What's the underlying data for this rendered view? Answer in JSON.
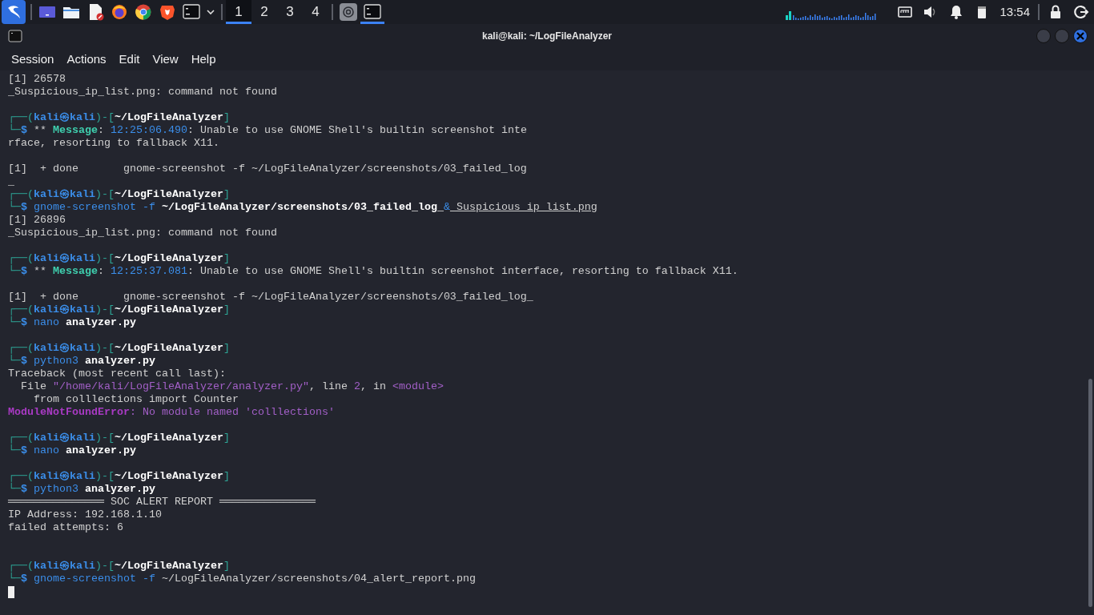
{
  "taskbar": {
    "workspaces": [
      {
        "label": "1",
        "selected": true
      },
      {
        "label": "2",
        "selected": false
      },
      {
        "label": "3",
        "selected": false
      },
      {
        "label": "4",
        "selected": false
      }
    ],
    "tasks": [
      {
        "kind": "assistant",
        "active": false
      },
      {
        "kind": "terminal",
        "active": true
      }
    ],
    "clock": "13:54"
  },
  "window": {
    "title": "kali@kali: ~/LogFileAnalyzer"
  },
  "menu": [
    "Session",
    "Actions",
    "Edit",
    "View",
    "Help"
  ],
  "terminal": {
    "lines": [
      {
        "kind": "text",
        "segments": [
          {
            "kind": "plain",
            "text": "[1] 26578"
          }
        ]
      },
      {
        "kind": "text",
        "segments": [
          {
            "kind": "plain",
            "text": "_Suspicious_ip_list.png: command not found"
          }
        ]
      },
      {
        "kind": "blank"
      },
      {
        "kind": "text",
        "segments": [
          {
            "kind": "frame",
            "text": "┌──("
          },
          {
            "kind": "user",
            "text": "kali㉿kali"
          },
          {
            "kind": "frame",
            "text": ")-["
          },
          {
            "kind": "path",
            "text": "~/LogFileAnalyzer"
          },
          {
            "kind": "frame",
            "text": "]"
          }
        ]
      },
      {
        "kind": "text",
        "segments": [
          {
            "kind": "frame",
            "text": "└─"
          },
          {
            "kind": "user",
            "text": "$"
          },
          {
            "kind": "plain",
            "text": " ** "
          },
          {
            "kind": "msg",
            "text": "Message"
          },
          {
            "kind": "plain",
            "text": ": "
          },
          {
            "kind": "cmd",
            "text": "12:25:06.490"
          },
          {
            "kind": "plain",
            "text": ": Unable to use GNOME Shell's builtin screenshot inte"
          }
        ]
      },
      {
        "kind": "text",
        "segments": [
          {
            "kind": "plain",
            "text": "rface, resorting to fallback X11."
          }
        ]
      },
      {
        "kind": "blank"
      },
      {
        "kind": "text",
        "segments": [
          {
            "kind": "plain",
            "text": "[1]  + done       gnome-screenshot -f ~/LogFileAnalyzer/screenshots/03_failed_log"
          }
        ]
      },
      {
        "kind": "text",
        "segments": [
          {
            "kind": "plain",
            "text": "_"
          }
        ]
      },
      {
        "kind": "text",
        "segments": [
          {
            "kind": "frame",
            "text": "┌──("
          },
          {
            "kind": "user",
            "text": "kali㉿kali"
          },
          {
            "kind": "frame",
            "text": ")-["
          },
          {
            "kind": "path",
            "text": "~/LogFileAnalyzer"
          },
          {
            "kind": "frame",
            "text": "]"
          }
        ]
      },
      {
        "kind": "text",
        "segments": [
          {
            "kind": "frame",
            "text": "└─"
          },
          {
            "kind": "user",
            "text": "$"
          },
          {
            "kind": "cmd",
            "text": " gnome-screenshot -f"
          },
          {
            "kind": "arg",
            "text": " ~/LogFileAnalyzer/screenshots/03_failed_log_"
          },
          {
            "kind": "cmd",
            "text": "&"
          },
          {
            "kind": "underline",
            "text": "_Suspicious_ip_list.png"
          }
        ]
      },
      {
        "kind": "text",
        "segments": [
          {
            "kind": "plain",
            "text": "[1] 26896"
          }
        ]
      },
      {
        "kind": "text",
        "segments": [
          {
            "kind": "plain",
            "text": "_Suspicious_ip_list.png: command not found"
          }
        ]
      },
      {
        "kind": "blank"
      },
      {
        "kind": "text",
        "segments": [
          {
            "kind": "frame",
            "text": "┌──("
          },
          {
            "kind": "user",
            "text": "kali㉿kali"
          },
          {
            "kind": "frame",
            "text": ")-["
          },
          {
            "kind": "path",
            "text": "~/LogFileAnalyzer"
          },
          {
            "kind": "frame",
            "text": "]"
          }
        ]
      },
      {
        "kind": "text",
        "segments": [
          {
            "kind": "frame",
            "text": "└─"
          },
          {
            "kind": "user",
            "text": "$"
          },
          {
            "kind": "plain",
            "text": " ** "
          },
          {
            "kind": "msg",
            "text": "Message"
          },
          {
            "kind": "plain",
            "text": ": "
          },
          {
            "kind": "cmd",
            "text": "12:25:37.081"
          },
          {
            "kind": "plain",
            "text": ": Unable to use GNOME Shell's builtin screenshot interface, resorting to fallback X11."
          }
        ]
      },
      {
        "kind": "blank"
      },
      {
        "kind": "text",
        "segments": [
          {
            "kind": "plain",
            "text": "[1]  + done       gnome-screenshot -f ~/LogFileAnalyzer/screenshots/03_failed_log_"
          }
        ]
      },
      {
        "kind": "text",
        "segments": [
          {
            "kind": "frame",
            "text": "┌──("
          },
          {
            "kind": "user",
            "text": "kali㉿kali"
          },
          {
            "kind": "frame",
            "text": ")-["
          },
          {
            "kind": "path",
            "text": "~/LogFileAnalyzer"
          },
          {
            "kind": "frame",
            "text": "]"
          }
        ]
      },
      {
        "kind": "text",
        "segments": [
          {
            "kind": "frame",
            "text": "└─"
          },
          {
            "kind": "user",
            "text": "$"
          },
          {
            "kind": "cmd",
            "text": " nano"
          },
          {
            "kind": "arg",
            "text": " analyzer.py"
          }
        ]
      },
      {
        "kind": "blank"
      },
      {
        "kind": "text",
        "segments": [
          {
            "kind": "frame",
            "text": "┌──("
          },
          {
            "kind": "user",
            "text": "kali㉿kali"
          },
          {
            "kind": "frame",
            "text": ")-["
          },
          {
            "kind": "path",
            "text": "~/LogFileAnalyzer"
          },
          {
            "kind": "frame",
            "text": "]"
          }
        ]
      },
      {
        "kind": "text",
        "segments": [
          {
            "kind": "frame",
            "text": "└─"
          },
          {
            "kind": "user",
            "text": "$"
          },
          {
            "kind": "cmd",
            "text": " python3"
          },
          {
            "kind": "arg",
            "text": " analyzer.py"
          }
        ]
      },
      {
        "kind": "text",
        "segments": [
          {
            "kind": "plain",
            "text": "Traceback (most recent call last):"
          }
        ]
      },
      {
        "kind": "text",
        "segments": [
          {
            "kind": "plain",
            "text": "  File "
          },
          {
            "kind": "purple",
            "text": "\"/home/kali/LogFileAnalyzer/analyzer.py\""
          },
          {
            "kind": "plain",
            "text": ", line "
          },
          {
            "kind": "purple",
            "text": "2"
          },
          {
            "kind": "plain",
            "text": ", in "
          },
          {
            "kind": "purple",
            "text": "<module>"
          }
        ]
      },
      {
        "kind": "text",
        "segments": [
          {
            "kind": "plain",
            "text": "    from colllections import Counter"
          }
        ]
      },
      {
        "kind": "text",
        "segments": [
          {
            "kind": "error",
            "text": "ModuleNotFoundError"
          },
          {
            "kind": "purple",
            "text": ": No module named 'colllections'"
          }
        ]
      },
      {
        "kind": "blank"
      },
      {
        "kind": "text",
        "segments": [
          {
            "kind": "frame",
            "text": "┌──("
          },
          {
            "kind": "user",
            "text": "kali㉿kali"
          },
          {
            "kind": "frame",
            "text": ")-["
          },
          {
            "kind": "path",
            "text": "~/LogFileAnalyzer"
          },
          {
            "kind": "frame",
            "text": "]"
          }
        ]
      },
      {
        "kind": "text",
        "segments": [
          {
            "kind": "frame",
            "text": "└─"
          },
          {
            "kind": "user",
            "text": "$"
          },
          {
            "kind": "cmd",
            "text": " nano"
          },
          {
            "kind": "arg",
            "text": " analyzer.py"
          }
        ]
      },
      {
        "kind": "blank"
      },
      {
        "kind": "text",
        "segments": [
          {
            "kind": "frame",
            "text": "┌──("
          },
          {
            "kind": "user",
            "text": "kali㉿kali"
          },
          {
            "kind": "frame",
            "text": ")-["
          },
          {
            "kind": "path",
            "text": "~/LogFileAnalyzer"
          },
          {
            "kind": "frame",
            "text": "]"
          }
        ]
      },
      {
        "kind": "text",
        "segments": [
          {
            "kind": "frame",
            "text": "└─"
          },
          {
            "kind": "user",
            "text": "$"
          },
          {
            "kind": "cmd",
            "text": " python3"
          },
          {
            "kind": "arg",
            "text": " analyzer.py"
          }
        ]
      },
      {
        "kind": "text",
        "segments": [
          {
            "kind": "plain",
            "text": "═══════════════ SOC ALERT REPORT ═══════════════"
          }
        ]
      },
      {
        "kind": "text",
        "segments": [
          {
            "kind": "plain",
            "text": "IP Address: 192.168.1.10"
          }
        ]
      },
      {
        "kind": "text",
        "segments": [
          {
            "kind": "plain",
            "text": "failed attempts: 6"
          }
        ]
      },
      {
        "kind": "blank"
      },
      {
        "kind": "blank"
      },
      {
        "kind": "text",
        "segments": [
          {
            "kind": "frame",
            "text": "┌──("
          },
          {
            "kind": "user",
            "text": "kali㉿kali"
          },
          {
            "kind": "frame",
            "text": ")-["
          },
          {
            "kind": "path",
            "text": "~/LogFileAnalyzer"
          },
          {
            "kind": "frame",
            "text": "]"
          }
        ]
      },
      {
        "kind": "text",
        "segments": [
          {
            "kind": "frame",
            "text": "└─"
          },
          {
            "kind": "user",
            "text": "$"
          },
          {
            "kind": "cmd",
            "text": " gnome-screenshot -f"
          },
          {
            "kind": "plain",
            "text": " ~/LogFileAnalyzer/screenshots/04_alert_report.png"
          }
        ]
      },
      {
        "kind": "cursor"
      }
    ]
  }
}
